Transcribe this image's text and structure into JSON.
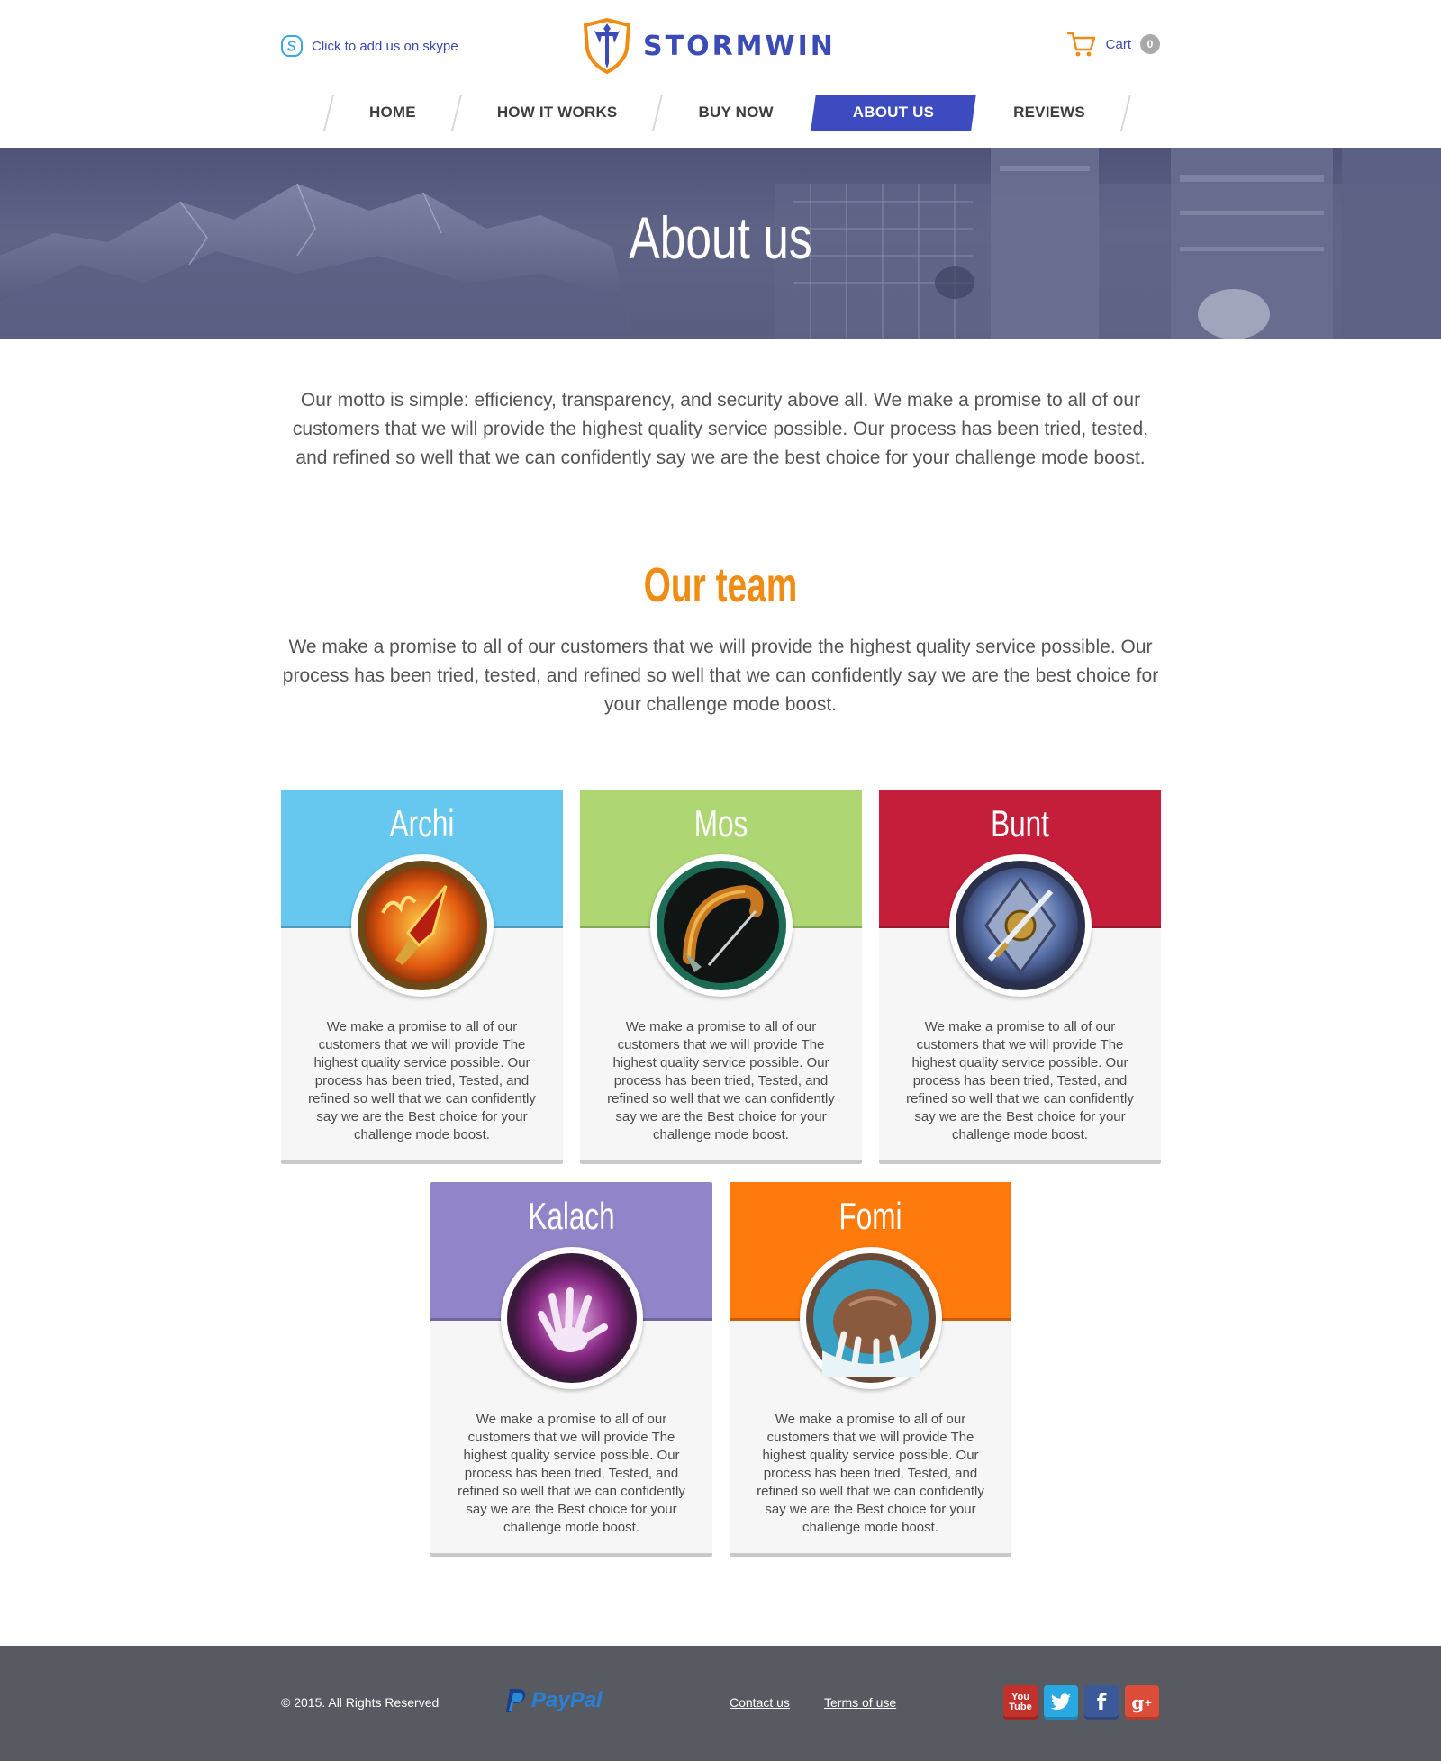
{
  "header": {
    "skype_label": "Click to add us on skype",
    "logo_text": "STORMWIN",
    "cart_label": "Cart",
    "cart_count": "0"
  },
  "nav": {
    "items": [
      {
        "label": "HOME",
        "active": false
      },
      {
        "label": "HOW IT WORKS",
        "active": false
      },
      {
        "label": "BUY NOW",
        "active": false
      },
      {
        "label": "ABOUT US",
        "active": true
      },
      {
        "label": "REVIEWS",
        "active": false
      }
    ]
  },
  "hero": {
    "title": "About us"
  },
  "intro": "Our motto is simple: efficiency, transparency, and security above all. We make a promise to all of our customers that we will provide the highest quality service possible. Our process has been tried, tested, and refined so well that we can confidently say we are the best choice for your challenge mode boost.",
  "team": {
    "title": "Our team",
    "intro": "We make a promise to all of our customers that we will provide the highest quality service possible. Our process has been tried, tested, and refined so well that we can confidently say we are the best choice for your challenge mode boost.",
    "members": [
      {
        "name": "Archi",
        "color": "#66c8ee",
        "icon": "flaming-crystal-icon",
        "bio": "We make a promise to all of our customers that we will provide The highest quality service possible. Our process has been tried, Tested, and refined so well that we can confidently say we are the Best choice for your challenge mode boost."
      },
      {
        "name": "Mos",
        "color": "#aed673",
        "icon": "hunter-bow-icon",
        "bio": "We make a promise to all of our customers that we will provide The highest quality service possible. Our process has been tried, Tested, and refined so well that we can confidently say we are the Best choice for your challenge mode boost."
      },
      {
        "name": "Bunt",
        "color": "#c41e3a",
        "icon": "shield-sword-icon",
        "bio": "We make a promise to all of our customers that we will provide The highest quality service possible. Our process has been tried, Tested, and refined so well that we can confidently say we are the Best choice for your challenge mode boost."
      },
      {
        "name": "Kalach",
        "color": "#9284c8",
        "icon": "shadow-hand-icon",
        "bio": "We make a promise to all of our customers that we will provide The highest quality service possible. Our process has been tried, Tested, and refined so well that we can confidently say we are the Best choice for your challenge mode boost."
      },
      {
        "name": "Fomi",
        "color": "#ff7a0c",
        "icon": "bear-claw-icon",
        "bio": "We make a promise to all of our customers that we will provide The highest quality service possible. Our process has been tried, Tested, and refined so well that we can confidently say we are the Best choice for your challenge mode boost."
      }
    ]
  },
  "footer": {
    "copyright": "© 2015. All Rights Reserved",
    "paypal": "PayPal",
    "links": [
      "Contact us",
      "Terms of use"
    ],
    "socials": [
      "youtube-icon",
      "twitter-icon",
      "facebook-icon",
      "google-plus-icon"
    ]
  },
  "colors": {
    "brand_blue": "#3c4bc0",
    "accent_orange": "#f08c14",
    "footer_bg": "#575a61"
  }
}
